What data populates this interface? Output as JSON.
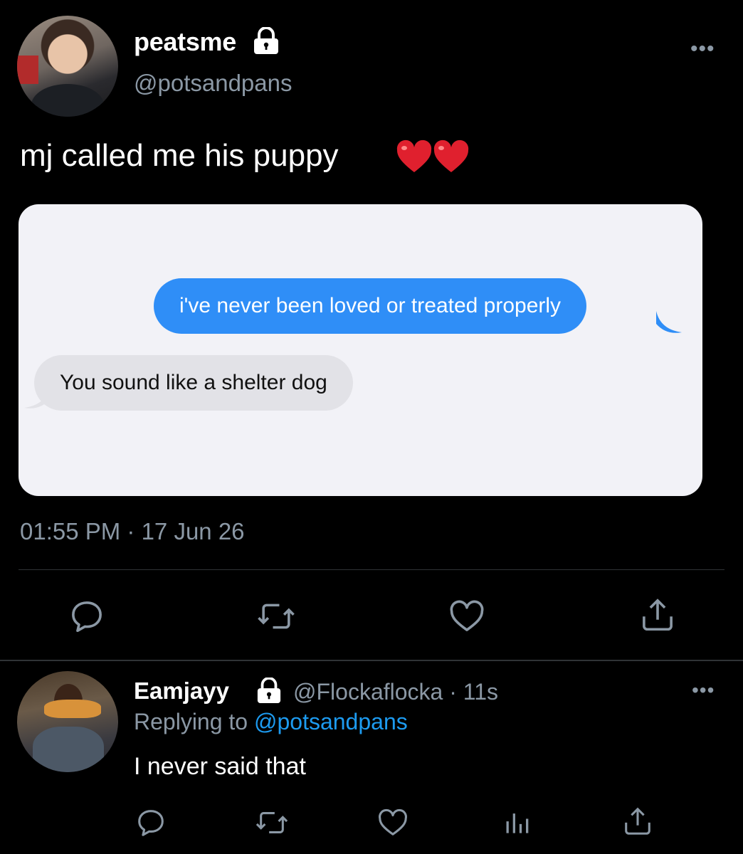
{
  "main_tweet": {
    "display_name": "peatsme",
    "handle": "@potsandpans",
    "text": "mj called me his puppy",
    "emoji": "red-heart x2",
    "media": {
      "sent_message": "i've never been loved or treated properly",
      "received_message": "You sound like a shelter dog"
    },
    "timestamp": "01:55 PM · 17 Jun 26",
    "more_label": "•••",
    "actions": [
      "reply-icon",
      "retweet-icon",
      "like-icon",
      "share-icon"
    ]
  },
  "reply_tweet": {
    "display_name": "Eamjayy",
    "handle_time": "@Flockaflocka · 11s",
    "replying_prefix": "Replying to",
    "replying_mention": "@potsandpans",
    "text": "I never said that",
    "more_label": "•••",
    "actions": [
      "reply-icon",
      "retweet-icon",
      "like-icon",
      "analytics-icon",
      "share-icon"
    ]
  },
  "colors": {
    "background": "#000000",
    "secondary_text": "#8b98a5",
    "link": "#1d9bf0",
    "imessage_blue": "#2f8ef7",
    "imessage_gray": "#e2e2e7",
    "heart_red": "#e0202e"
  }
}
